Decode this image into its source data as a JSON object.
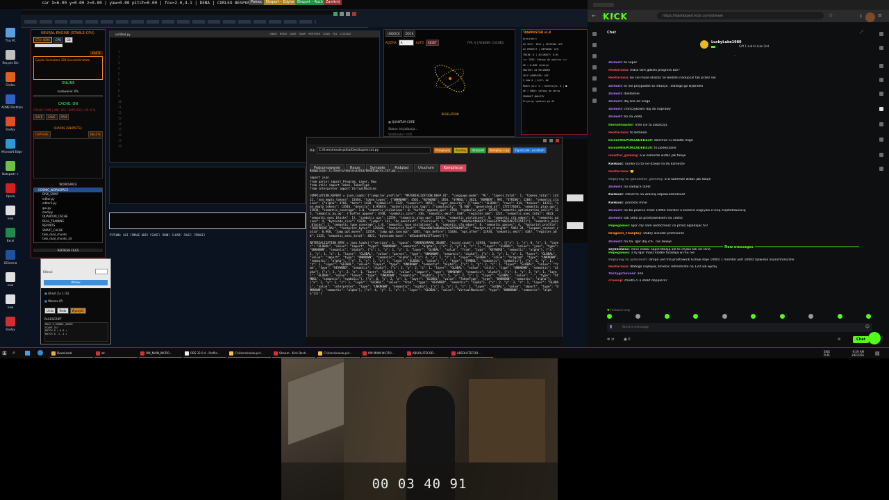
{
  "top_bar": {
    "text": "car X=6.00 y=0.00 z=0.00 | yaw=0.00 pitch=0.00 | fov=2.0,4.1 | DENA | CORLEO BESPORT",
    "chips": [
      "Pomoc",
      "Eksport – Edytor",
      "Eksport – Ruch",
      "Zamknij"
    ]
  },
  "desktop_icons": [
    {
      "label": "This PC",
      "color": "#5aa0e0"
    },
    {
      "label": "Recycle Bin",
      "color": "#c0c0c0"
    },
    {
      "label": "Firefox",
      "color": "#e06020"
    },
    {
      "label": "AOMEI Partition",
      "color": "#3060c0"
    },
    {
      "label": "Firefox",
      "color": "#e0502a"
    },
    {
      "label": "Microsoft Edge",
      "color": "#2a9ad0"
    },
    {
      "label": "Notepad++",
      "color": "#6fbf40"
    },
    {
      "label": "Opera",
      "color": "#d02020"
    },
    {
      "label": "new",
      "color": "#e0e0e0"
    },
    {
      "label": "Excel",
      "color": "#1f8a4a"
    },
    {
      "label": "OCinema",
      "color": "#2050a0"
    },
    {
      "label": "new",
      "color": "#e0e0e0"
    },
    {
      "label": "new",
      "color": "#e0e0e0"
    },
    {
      "label": "Firefox",
      "color": "#d03030"
    }
  ],
  "neural": {
    "title": "NEURAL ENGINE (STABLE-CPU)",
    "mode_buttons": [
      "CTX: 4096",
      "CPU",
      "GB"
    ],
    "ignite": "IGNITE",
    "model": "Goede-Formalizer-32B-SonnetAnnotate",
    "status": "ONLINE",
    "loading": "Ładowanie: 0%",
    "cache_status": "CACHE: ON",
    "cache_stats": "CACHE: 0 KB | UNI: 125 | RAM: 653 | OS: 6 %",
    "cache_buttons": [
      "SAFE",
      "SAVE",
      "RAM"
    ],
    "quarks_title": "QUARKS (SNIPPETS):",
    "quarks_buttons": [
      "CAPTURE",
      "DELETE"
    ],
    "workspace_title": "WORKSPACE",
    "tree": [
      "COSMIC_WORKSPACE",
      "DISK_SWAP",
      "editor.py",
      "editor2.py",
      "gui.py",
      "mod.py",
      "QUANTUM_CACHE",
      "REAL_TRAINING",
      "REPORTS",
      "SMART_CACHE",
      "task_dual_chunks",
      "task_dual_chunks_2d"
    ],
    "refresh": "REFRESH FILES",
    "klienci_label": "Klienci:",
    "wstaw": "Wstaw",
    "checks": [
      "Ghost Z± 1 (G)",
      "Wzorce (P)"
    ],
    "bottom_buttons": [
      "Undo",
      "Redo",
      "Wyczyść"
    ],
    "rulescript_title": "RULESCRIPT",
    "rulescript_lines": [
      "RULE X_KERNEL_BOOST",
      "SCOPE 3×7",
      "MATCH 0 = 0.6 ▾",
      "MATCH 0 -1 -1 ▸"
    ]
  },
  "editor": {
    "filename": "untitled.py",
    "toolbar": [
      "UNDO",
      "REDO",
      "SAVE",
      "SNAP",
      "RESTORE",
      "LOAD",
      "FILL",
      "Ω SCALE"
    ],
    "status_line": "PYTHON: GUI  [IMAGE ADD]  [SAVE]  [RUN]  [LOAD]  [BLE]  [IMAGE]",
    "line_count": 18
  },
  "viz": {
    "tabs": [
      "UNDOCK",
      "DOCK"
    ],
    "controls": [
      "ACKTRX",
      "A",
      "AUTO",
      "RESET"
    ],
    "info": "FPS: 0 | RENDER: CACHED",
    "caption": "REVELATION",
    "quantum_title": "QUANTUM CORE",
    "quantum_status": "Status: Inicjalizacja...",
    "quantum_sub": "Stabilizator: 0.00"
  },
  "taskpuster": {
    "title": "TASKPUSTER v1.8",
    "lines": [
      "Architect:",
      "AI SELF: IDLE | SESSION: OFF",
      "AI PREDICT | NETWORK: 0/0",
      "TRAIN: 0 | ACCURACY: 0.0%",
      "=== TASK: Gotowy do analizy ===",
      "dE = 0.000 rotacja",
      "ROUTER: AI RECORDED",
      "SELF-COMPUTER: OFF",
      "5 ROW 0 | GLIF: OK",
      "Model pts: 0 | Generacja: 0 | ■",
      "dE = 0000: Gotowy do seria",
      "PRODUKT ANALIZY",
      "Przyczyn wymiaru po 45"
    ]
  },
  "codewin": {
    "path_label": "Plik:",
    "path": "C:/Users/noula-pidia/Desktop/ss.txt.py",
    "top_buttons": [
      "Przeglądaj",
      "Analizuj",
      "Interpret",
      "Kompiluj → py",
      "Zapisz plik i uruchom"
    ],
    "tabs": [
      "Podsumowanie",
      "Haszy",
      "Symbole",
      "Podgląd",
      "Uruchom",
      "Kompilacja"
    ],
    "code": "Kompiluje: C:/Users/noula-pidia/Desktop/ss.txt.py ...\n\nimport json\nfrom parser import Program, Layer, Row\nfrom utils import Token, TokenType\nfrom interpreter import VirtualMachine\n\nCOMPILATION_REPORT = json.loads('{\"compiler_profile\": \"MATERIALIZATION_DEEP_V1\", \"language_mode\": \"PL\", \"layers_total\": 1, \"tokens_total\": 14322, \"non_empty_tokens\": 13584, \"token_types\": {\"UNKNOWN\": 4501, \"KEYWORD\": 1854, \"SYMBOL\": 3821, \"NUMBER\": 992, \"STRING\": 1204}, \"semantic_classes\": {\"alpha\": 4766, \"beta\": 1438, \"symbolic\": 2322, \"numeric\": 2051}, \"layer_density\": [{\"name\": \"GLOBAL\", \"rows\": 414, \"tokens\": 14322, \"non_empty_tokens\": 13584, \"density\": 0.9484}], \"materialization_tags\": {\"complexity\": \"0.706\", \"generated_at\": 1772776381, \"semantic_plan_ops\": 12934, \"semantic_coverage\": 1.0, \"semantic_violations\": 0, \"buffer_append_ops\": 4768, \"symbolic_ops\": 12559, \"semantic_optimization_calls\": 325, \"semantic_by_op\": {\"buffer_append\": 4768, \"symbolic_core\": 336, \"semantic_emit\": 4347, \"register_add\": 1225, \"semantic_exec_total\": 4823, \"semantic_exec_blocks\": 1}, \"symbolic_ops\": 12559, \"semantic_plan_ops\": 12934, \"semantic_violations\": 0, \"semantic_cfg_edges\": 8, \"semantic_passes\": 4, \"bytecode_size\": 51834, \"jumps\": 14}, \"ds_manifest\": {\"version\": 1, \"hash\": \"b80c6ef4b8d1771aee147ff8022d673125421\"}, \"semantic_exec_blocks\": 1, \"semantic_type_coverage\": 1.0, \"semantic_type_violations\": 0, \"semantic_cfg_edges\": 8, \"semantic_passes\": 4, \"footprint_profile\": \"FOOTPRINT_VAL\", \"footprint_bytes\": 125648, \"footprint_hash\": \"f6ae4987ad6d8e2a2d7f8b49f1a\", \"footprint_strength\": 5963.24, \"loopmet_context_ratio\": 0.968, \"jump_opt_moves\": 12559, \"jump_opt_savings\": 1035, \"ops_before\": 51834, \"ops_after\": 12934, \"semantic_emit\": 4347, \"register_add\": 1225, \"semantic_exec_total\": 4823, \"bytecode_hash\": \"b81a4e6f8d1771aee1\"}')\n\nMATERIALIZATION_SPEC = json.loads('{\"version\": 1, \"space\": \"ORBENCHMARK_3DAND\", \"scoid_count\": 12934, \"nodes\": [{\"x\": 1, \"y\": 0, \"z\": 1, \"layer\": \"GLOBAL\", \"value\": \"import\", \"type\": \"UNKNOWN\", \"semantic\": \"alpha\"}, {\"x\": 2, \"y\": 0, \"z\": 1, \"layer\": \"GLOBAL\", \"value\": \"json\", \"type\": \"UNKNOWN\", \"semantic\": \"alpha\"}, {\"x\": 1, \"y\": 1, \"z\": 1, \"layer\": \"GLOBAL\", \"value\": \"from\", \"type\": \"KEYWORD\", \"semantic\": \"alpha\"}, {\"x\": 2, \"y\": 1, \"z\": 1, \"layer\": \"GLOBAL\", \"value\": \"parser\", \"type\": \"UNKNOWN\", \"semantic\": \"alpha\"}, {\"x\": 3, \"y\": 1, \"z\": 1, \"layer\": \"GLOBAL\", \"value\": \"import\", \"type\": \"UNKNOWN\", \"semantic\": \"alpha\"}, {\"x\": 4, \"y\": 1, \"z\": 1, \"layer\": \"GLOBAL\", \"value\": \"Program\", \"type\": \"UNKNOWN\", \"semantic\": \"alpha\"}, {\"x\": 5, \"y\": 1, \"z\": 1, \"layer\": \"GLOBAL\", \"value\": \",\", \"type\": \"SYMBOL\", \"semantic\": \"symbolic\"}, {\"x\": 6, \"y\": 1, \"z\": 1, \"layer\": \"GLOBAL\", \"value\": \"Layer\", \"type\": \"UNKNOWN\", \"semantic\": \"alpha\"}, {\"x\": 1, \"y\": 2, \"z\": 1, \"layer\": \"GLOBAL\", \"value\": \"from\", \"type\": \"KEYWORD\", \"semantic\": \"alpha\"}, {\"x\": 2, \"y\": 2, \"z\": 1, \"layer\": \"GLOBAL\", \"value\": \"utils\", \"type\": \"UNKNOWN\", \"semantic\": \"alpha\"}, {\"x\": 3, \"y\": 2, \"z\": 1, \"layer\": \"GLOBAL\", \"value\": \"import\", \"type\": \"UNKNOWN\", \"semantic\": \"alpha\"}, {\"x\": 4, \"y\": 2, \"z\": 1, \"layer\": \"GLOBAL\", \"value\": \"Token\", \"type\": \"UNKNOWN\", \"semantic\": \"alpha\"}, {\"x\": 5, \"y\": 2, \"z\": 1, \"layer\": \"GLOBAL\", \"value\": \",\", \"type\": \"SYMBOL\", \"semantic\": \"symbolic\"}, {\"x\": 6, \"y\": 2, \"z\": 1, \"layer\": \"GLOBAL\", \"value\": \"TokenType\", \"type\": \"UNKNOWN\", \"semantic\": \"alpha\"}, {\"x\": 1, \"y\": 3, \"z\": 1, \"layer\": \"GLOBAL\", \"value\": \"from\", \"type\": \"KEYWORD\", \"semantic\": \"alpha\"}, {\"x\": 2, \"y\": 3, \"z\": 1, \"layer\": \"GLOBAL\", \"value\": \"interpreter\", \"type\": \"UNKNOWN\", \"semantic\": \"alpha\"}, {\"x\": 3, \"y\": 3, \"z\": 1, \"layer\": \"GLOBAL\", \"value\": \"import\", \"type\": \"UNKNOWN\", \"semantic\": \"alpha\"}, {\"x\": 4, \"y\": 3, \"z\": 1, \"layer\": \"GLOBAL\", \"value\": \"VirtualMachine\", \"type\": \"UNKNOWN\", \"semantic\": \"alpha\"}]}')"
  },
  "taskbar": {
    "items": [
      {
        "label": "Downloads",
        "color": "#e0b040"
      },
      {
        "label": "wt",
        "color": "#d03030"
      },
      {
        "label": "OM_MAIN_INCRO...",
        "color": "#d03030"
      },
      {
        "label": "OBS 32.0.4 - Profile...",
        "color": "#f0f0f0"
      },
      {
        "label": "C:\\Users\\noula-pid...",
        "color": "#f0c040"
      },
      {
        "label": "Stream - Kick Dash...",
        "color": "#d03030"
      },
      {
        "label": "C:\\Users\\noula-pid...",
        "color": "#f0c040"
      },
      {
        "label": "OM MAIN IN CRO...",
        "color": "#d03030"
      },
      {
        "label": "ABSOLUTECOD...",
        "color": "#d03030"
      },
      {
        "label": "ABSOLUTECOD...",
        "color": "#d03030"
      }
    ],
    "lang": "ENG",
    "lang2": "PLPL",
    "time": "9:59 AM",
    "date": "3/6/2026"
  },
  "browser": {
    "url": "https://dashboard.kick.com/stream",
    "logo": "KICK",
    "chat_title": "Chat",
    "pinned_user": "LuckyLuke1980",
    "pinned_text": "Gift 1 sub to luke 2nd",
    "brand_color": "#53fc18",
    "messages": [
      {
        "user": "zbimoti",
        "color": "#b47cff",
        "text": "to super"
      },
      {
        "user": "Hextoriosa",
        "color": "#ff4d4d",
        "text": "masz tam gdzies progress bar?"
      },
      {
        "user": "Hextoriosa",
        "color": "#ff4d4d",
        "text": "bo sie moze okazac ze bedzeli nadupcal tak przez rok"
      },
      {
        "user": "zbimoti",
        "color": "#b47cff",
        "text": "to nie przypadek to intuicja , dlatego go wybrałeś"
      },
      {
        "user": "zbimoti",
        "color": "#b47cff",
        "text": "dokładnie"
      },
      {
        "user": "zbimoti",
        "color": "#b47cff",
        "text": "daj link do niego"
      },
      {
        "user": "zbimoti",
        "color": "#b47cff",
        "text": "chińczykowni daj do naprawy"
      },
      {
        "user": "zbimoti",
        "color": "#b47cff",
        "text": "bo na Zeda"
      },
      {
        "user": "thenotmaster",
        "color": "#53fc18",
        "text": "mile cie tu zobaczyc"
      },
      {
        "user": "Hextoriosa",
        "color": "#ff4d4d",
        "text": "to bdzieaa"
      },
      {
        "user": "ksiezeNIEPORZADEK420",
        "color": "#53fc18",
        "text": "dziennie Ci światło miga"
      },
      {
        "user": "ksiezeNIEPORZADEK420",
        "color": "#53fc18",
        "text": "to podejrzane"
      },
      {
        "user": "monitor_gaming",
        "color": "#ff4d4d",
        "text": "a w kamerze widac jak faluje"
      },
      {
        "user": "Kwikusc",
        "color": "#e0e0e0",
        "text": "kurwo co to sie dzieje na tej kamerze"
      },
      {
        "user": "Hextoriosa",
        "color": "#ff4d4d",
        "text": "🙂"
      },
      {
        "user": "Replying to @monitor_gaming",
        "color": "#777777",
        "text": "a w kamerze widac jak faluje"
      },
      {
        "user": "zbimoti",
        "color": "#b47cff",
        "text": "no nadajca 50Hz"
      },
      {
        "user": "Kwikusc",
        "color": "#e0e0e0",
        "text": "robisz to na własną odpowiedzialność"
      },
      {
        "user": "Kwikusc",
        "color": "#e0e0e0",
        "text": "poirosto mnie"
      },
      {
        "user": "zbimoti",
        "color": "#b47cff",
        "text": "no bo pewnie masz 100hz monitor a kamera nagrywa z inną częstotliwością"
      },
      {
        "user": "zbimoti",
        "color": "#b47cff",
        "text": "tak 50hz za prostownikiem na 100hz"
      },
      {
        "user": "Pepegames",
        "color": "#53fc18",
        "text": "Igor czy nam widocznosc co przez ogladajac to?"
      },
      {
        "user": "Dragonn_Flowplay",
        "color": "#ff9a3c",
        "text": "Dobry wieczór profesorze"
      },
      {
        "user": "zbimoti",
        "color": "#b47cff",
        "text": "ha ha. Igor daj ich , nie zwieje"
      },
      {
        "user": "szybkiewoc",
        "color": "#e0e0e0",
        "text": "mnie zatoki napierdalają ale to chyba tak od rana"
      }
    ],
    "new_messages_label": "New messages",
    "new_messages": [
      {
        "user": "Pepegames",
        "color": "#53fc18",
        "text": "a ty Igor masz klatke faradaja w mu nie"
      },
      {
        "user": "Replying to @zbimoti",
        "color": "#777777",
        "text": "lampa Led ma prostownik Grzeje daje 100hz 1 monitor jest 100hz zjawisko asynchroniczne"
      },
      {
        "user": "Hextoriosa",
        "color": "#ff4d4d",
        "text": "dlatego najlepiej zmienic refreshrate na 120 lub wyzej"
      },
      {
        "user": "YasTygZ5ovaer",
        "color": "#b47cff",
        "text": "aha"
      },
      {
        "user": "crawwp",
        "color": "#ff4d4d",
        "text": "chodzi ci o efekt dopplera?"
      }
    ],
    "followers_only": "Followers only",
    "send_placeholder": "Send a message",
    "chat_button": "Chat",
    "counter": "0"
  },
  "webcam": {
    "clock": "00 03 40 91"
  }
}
